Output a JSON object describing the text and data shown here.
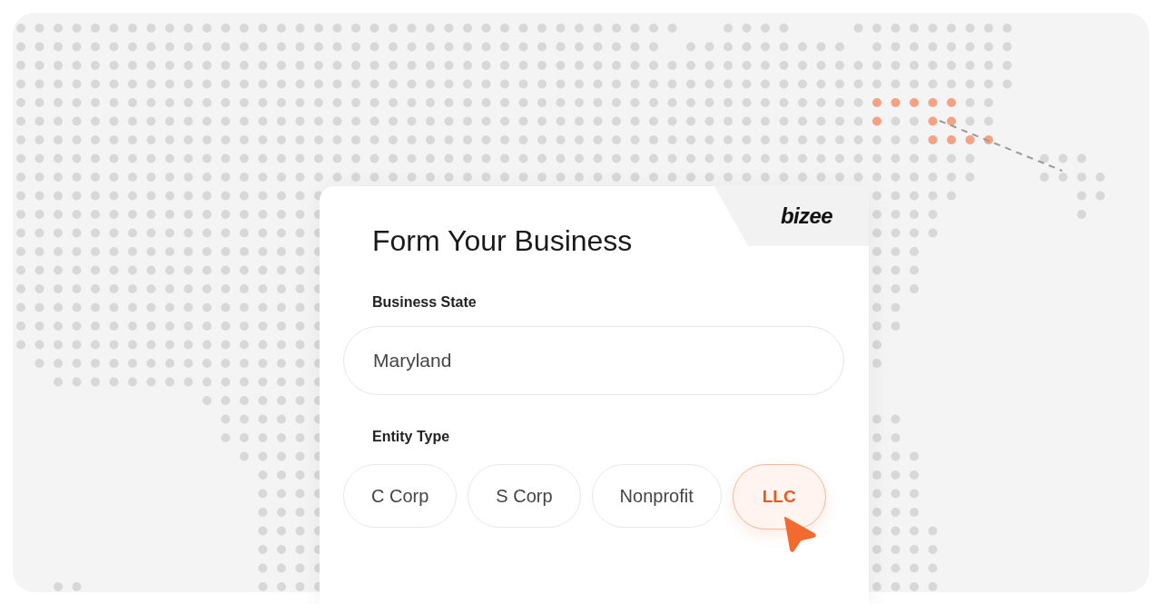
{
  "logo": "bizee",
  "title": "Form Your Business",
  "business_state": {
    "label": "Business State",
    "value": "Maryland"
  },
  "entity_type": {
    "label": "Entity Type",
    "options": [
      {
        "label": "C Corp",
        "selected": false
      },
      {
        "label": "S Corp",
        "selected": false
      },
      {
        "label": "Nonprofit",
        "selected": false
      },
      {
        "label": "LLC",
        "selected": true
      }
    ]
  }
}
